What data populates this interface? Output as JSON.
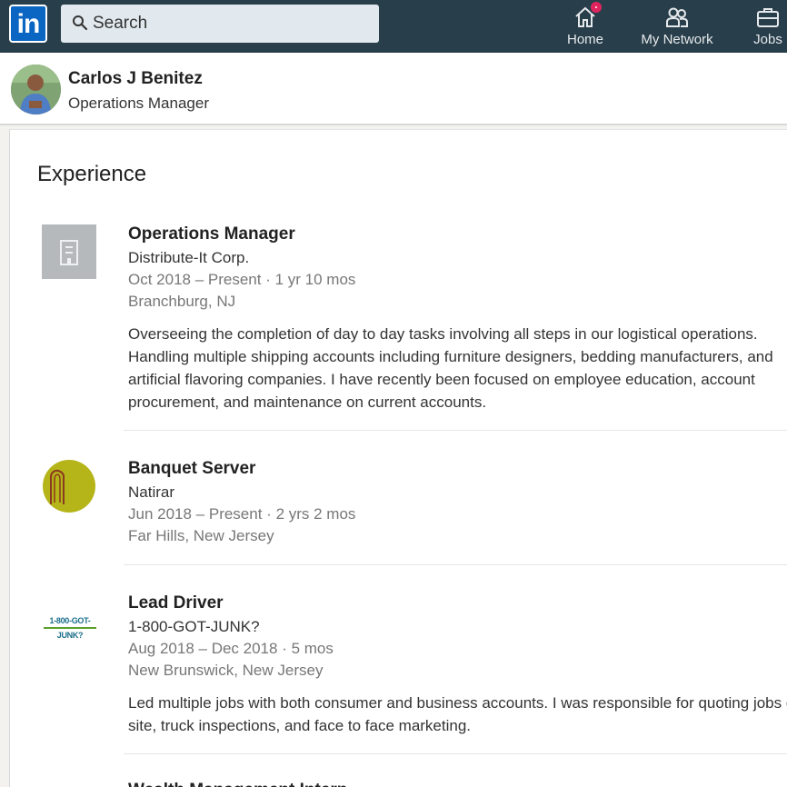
{
  "nav": {
    "logo_text": "in",
    "search_placeholder": "Search",
    "items": [
      {
        "label": "Home",
        "icon": "home-icon",
        "badge": true
      },
      {
        "label": "My Network",
        "icon": "people-icon"
      },
      {
        "label": "Jobs",
        "icon": "briefcase-icon"
      }
    ]
  },
  "profile": {
    "name": "Carlos J Benitez",
    "headline": "Operations Manager"
  },
  "experience": {
    "title": "Experience",
    "entries": [
      {
        "title": "Operations Manager",
        "company": "Distribute-It Corp.",
        "dates": "Oct 2018 – Present",
        "duration": "1 yr 10 mos",
        "location": "Branchburg, NJ",
        "description_lines": [
          "Overseeing the completion of day to day tasks involving all steps in our logistical operations.",
          "Handling multiple shipping accounts including furniture designers, bedding manufacturers, and",
          "artificial flavoring companies. I have recently been focused on employee education, account",
          "procurement, and maintenance on current accounts."
        ]
      },
      {
        "title": "Banquet Server",
        "company": "Natirar",
        "dates": "Jun 2018 – Present",
        "duration": "2 yrs 2 mos",
        "location": "Far Hills, New Jersey"
      },
      {
        "title": "Lead Driver",
        "company": "1-800-GOT-JUNK?",
        "logo_text": "1-800-GOT-JUNK?",
        "dates": "Aug 2018 – Dec 2018",
        "duration": "5 mos",
        "location": "New Brunswick, New Jersey",
        "description_lines": [
          "Led multiple jobs with both consumer and business accounts. I was responsible for quoting jobs on",
          "site, truck inspections, and face to face marketing."
        ]
      },
      {
        "title": "Wealth Management Intern"
      }
    ]
  },
  "colors": {
    "nav_bg": "#283e4a",
    "brand_blue": "#0a66c2",
    "badge_red": "#e0245e",
    "natirar_logo": "#b5b418"
  }
}
